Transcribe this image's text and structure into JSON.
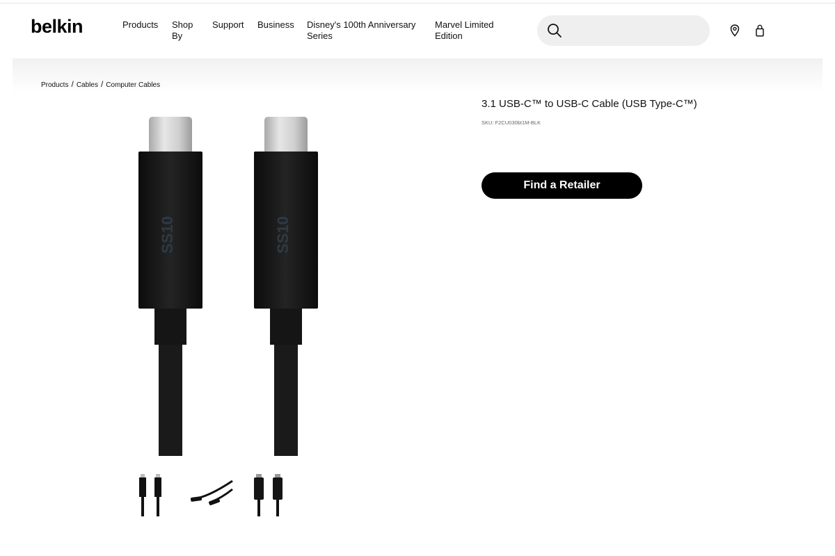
{
  "header": {
    "logo": "belkin",
    "nav": [
      {
        "label_line1": "Products",
        "label_line2": ""
      },
      {
        "label_line1": "Shop",
        "label_line2": "By"
      },
      {
        "label_line1": "Support",
        "label_line2": ""
      },
      {
        "label_line1": "Business",
        "label_line2": ""
      },
      {
        "label_line1": "Disney's 100th Anniversary",
        "label_line2": "Series"
      },
      {
        "label_line1": "Marvel Limited",
        "label_line2": "Edition"
      }
    ],
    "search": {
      "placeholder": "",
      "value": "",
      "icon": "search-icon"
    },
    "icons": [
      "location-pin-icon",
      "shopping-bag-icon"
    ]
  },
  "breadcrumb": [
    "Products",
    "Cables",
    "Computer Cables"
  ],
  "product": {
    "title": "3.1 USB-C™ to USB-C Cable (USB Type-C™)",
    "sku": "SKU: F2CU030bt1M-BLK",
    "cta_label": "Find a Retailer",
    "connector_marking": "SS10"
  },
  "gallery": {
    "thumbnail_count": 3,
    "selected_index": 0
  },
  "colors": {
    "brand": "#000000",
    "cta_bg": "#000000",
    "cta_text": "#ffffff",
    "search_bg": "#efefef",
    "cable": "#1a1a1a",
    "connector_metal": "#c9c9c9"
  }
}
